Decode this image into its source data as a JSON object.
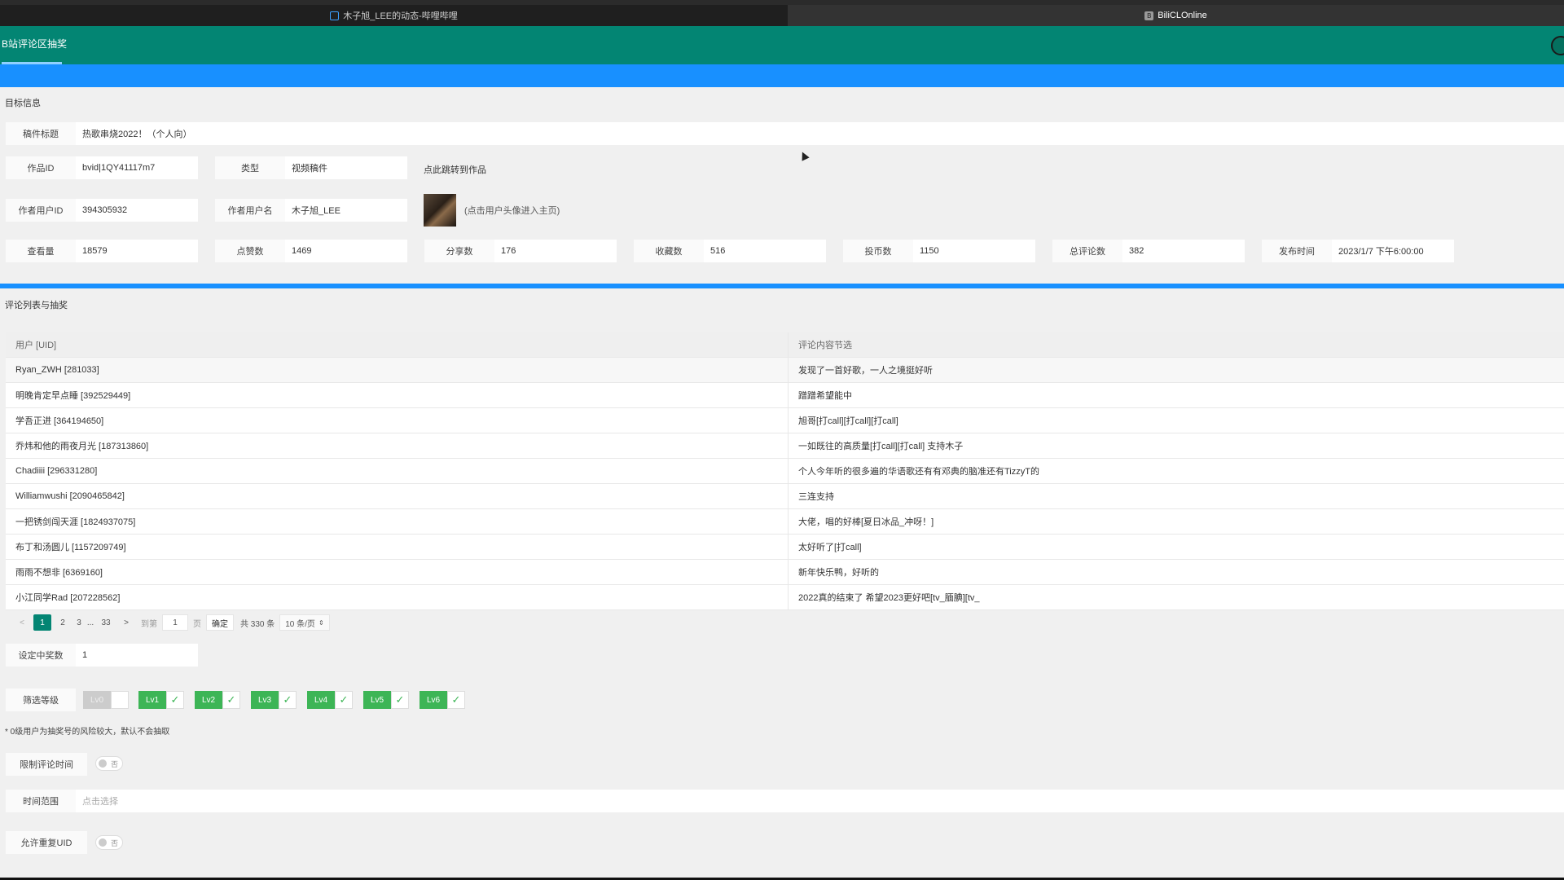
{
  "tabs": [
    {
      "label": "木子旭_LEE的动态-哔哩哔哩",
      "icon": "calendar-icon"
    },
    {
      "label": "BiliCLOnline",
      "icon": "app-icon",
      "icon_text": "B"
    }
  ],
  "app": {
    "title": "B站评论区抽奖"
  },
  "target": {
    "section_title": "目标信息",
    "title_label": "稿件标题",
    "title_value": "热歌串烧2022！（个人向）",
    "id_label": "作品ID",
    "id_value": "bvid|1QY41117m7",
    "type_label": "类型",
    "type_value": "视频稿件",
    "jump_link": "点此跳转到作品",
    "uid_label": "作者用户ID",
    "uid_value": "394305932",
    "uname_label": "作者用户名",
    "uname_value": "木子旭_LEE",
    "avatar_hint": "(点击用户头像进入主页)",
    "stats": [
      {
        "label": "查看量",
        "value": "18579"
      },
      {
        "label": "点赞数",
        "value": "1469"
      },
      {
        "label": "分享数",
        "value": "176"
      },
      {
        "label": "收藏数",
        "value": "516"
      },
      {
        "label": "投币数",
        "value": "1150"
      },
      {
        "label": "总评论数",
        "value": "382"
      },
      {
        "label": "发布时间",
        "value": "2023/1/7 下午6:00:00"
      }
    ]
  },
  "comments": {
    "section_title": "评论列表与抽奖",
    "headers": [
      "用户 [UID]",
      "评论内容节选"
    ],
    "rows": [
      [
        "Ryan_ZWH [281033]",
        "发现了一首好歌，一人之境挺好听"
      ],
      [
        "明晚肯定早点睡 [392529449]",
        "蹭蹭希望能中"
      ],
      [
        "学吾正进 [364194650]",
        "旭哥[打call][打call][打call]"
      ],
      [
        "乔炜和他的雨夜月光 [187313860]",
        "一如既往的高质量[打call][打call] 支持木子"
      ],
      [
        "Chadiiii [296331280]",
        "个人今年听的很多遍的华语歌还有有邓典的脑准还有TizzyT的"
      ],
      [
        "Williamwushi [2090465842]",
        "三连支持"
      ],
      [
        "一把锈剑闯天涯 [1824937075]",
        "大佬，唱的好棒[夏日冰品_冲呀！]"
      ],
      [
        "布丁和汤圆儿 [1157209749]",
        "太好听了[打call]"
      ],
      [
        "雨雨不想非 [6369160]",
        "新年快乐鸭，好听的"
      ],
      [
        "小江同学Rad [207228562]",
        "2022真的结束了 希望2023更好吧[tv_腼腆][tv_"
      ]
    ]
  },
  "pager": {
    "prev": "<",
    "pages": [
      "1",
      "2",
      "3"
    ],
    "ellipsis": "...",
    "last_page": "33",
    "next": ">",
    "goto_label": "到第",
    "goto_value": "1",
    "page_unit": "页",
    "confirm": "确定",
    "total": "共 330 条",
    "page_size": "10 条/页"
  },
  "lottery": {
    "winners_label": "设定中奖数",
    "winners_value": "1",
    "level_label": "筛选等级",
    "levels": [
      {
        "name": "Lv0",
        "checked": false
      },
      {
        "name": "Lv1",
        "checked": true
      },
      {
        "name": "Lv2",
        "checked": true
      },
      {
        "name": "Lv3",
        "checked": true
      },
      {
        "name": "Lv4",
        "checked": true
      },
      {
        "name": "Lv5",
        "checked": true
      },
      {
        "name": "Lv6",
        "checked": true
      }
    ],
    "check_mark": "✓",
    "level_note": "* 0级用户为抽奖号的风险较大，默认不会抽取",
    "limit_time_label": "限制评论时间",
    "limit_time_switch": "否",
    "time_range_label": "时间范围",
    "time_range_placeholder": "点击选择",
    "allow_dup_label": "允许重复UID",
    "allow_dup_switch": "否"
  },
  "colors": {
    "header": "#038573",
    "accent_blue": "#1890ff",
    "level_green": "#3db556"
  }
}
